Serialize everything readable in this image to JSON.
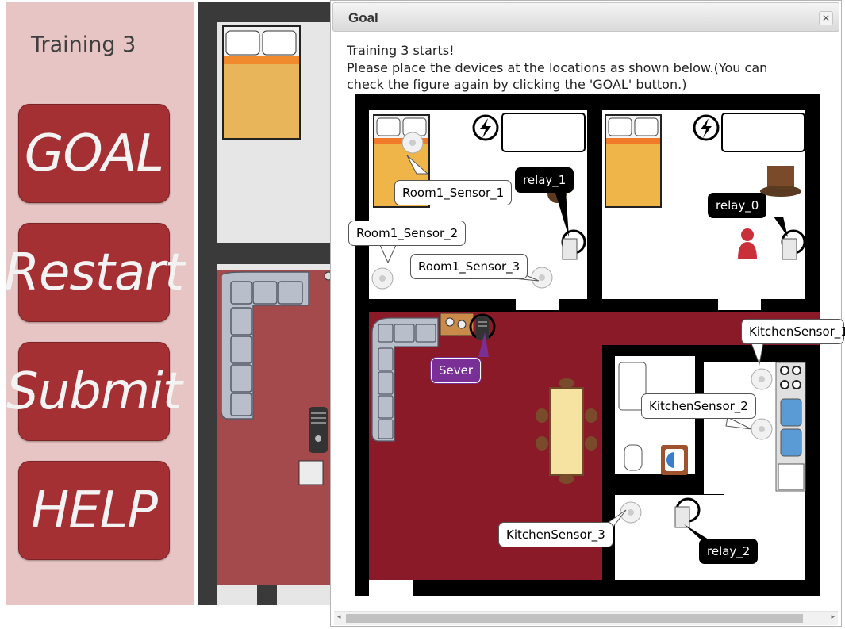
{
  "sidebar": {
    "title": "Training 3",
    "buttons": [
      {
        "label": "GOAL"
      },
      {
        "label": "Restart"
      },
      {
        "label": "Submit"
      },
      {
        "label": "HELP"
      }
    ]
  },
  "dialog": {
    "title": "Goal",
    "close_icon": "close-x",
    "lines": [
      "Training 3 starts!",
      "Please place the devices at the locations as shown below.(You can",
      "check the figure again by clicking the 'GOAL' button.)"
    ]
  },
  "labels": {
    "room1_sensor_1": "Room1_Sensor_1",
    "room1_sensor_2": "Room1_Sensor_2",
    "room1_sensor_3": "Room1_Sensor_3",
    "relay_0": "relay_0",
    "relay_1": "relay_1",
    "relay_2": "relay_2",
    "server": "Sever",
    "kitchen_sensor_1": "KitchenSensor_1",
    "kitchen_sensor_2": "KitchenSensor_2",
    "kitchen_sensor_3": "KitchenSensor_3"
  },
  "colors": {
    "sidebar_bg": "#e8c5c5",
    "button": "#a53033",
    "living_floor": "#8b1a28",
    "wall": "#000000",
    "server_label": "#7a2f97"
  }
}
